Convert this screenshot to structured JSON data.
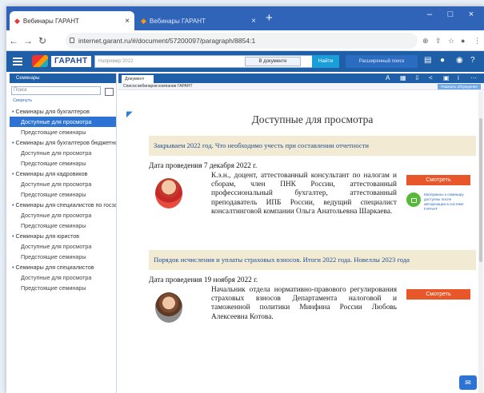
{
  "browser": {
    "tabs": [
      {
        "title": "Вебинары ГАРАНТ",
        "close": "×"
      },
      {
        "title": "Вебинары ГАРАНТ",
        "close": "×"
      }
    ],
    "new_tab": "+",
    "window_controls": [
      "–",
      "□",
      "×"
    ],
    "url": "internet.garant.ru/#/document/57200097/paragraph/8854:1"
  },
  "toolbar": {
    "logo": "ГАРАНТ",
    "search_placeholder": "Например 2022",
    "scope": "В документе",
    "find_label": "Найти",
    "extended_label": "Расширенный поиск"
  },
  "left_panel": {
    "title": "Семинары",
    "search_placeholder": "Поиск",
    "collapse_all": "Свернуть",
    "groups": [
      {
        "label": "Семинары для бухгалтеров",
        "items": [
          "Доступные для просмотра",
          "Предстоящие семинары"
        ]
      },
      {
        "label": "Семинары для бухгалтеров бюджетной сферы",
        "items": [
          "Доступные для просмотра",
          "Предстоящие семинары"
        ]
      },
      {
        "label": "Семинары для кадровиков",
        "items": [
          "Доступные для просмотра",
          "Предстоящие семинары"
        ]
      },
      {
        "label": "Семинары для специалистов по госзакупкам",
        "items": [
          "Доступные для просмотра",
          "Предстоящие семинары"
        ]
      },
      {
        "label": "Семинары для юристов",
        "items": [
          "Доступные для просмотра",
          "Предстоящие семинары"
        ]
      },
      {
        "label": "Семинары для специалистов",
        "items": [
          "Доступные для просмотра",
          "Предстоящие семинары"
        ]
      }
    ]
  },
  "doc": {
    "tab_label": "Документ",
    "breadcrumb": "Список вебинаров компании ГАРАНТ",
    "right_button": "Показать обсуждения",
    "page_title": "Доступные для просмотра",
    "entries": [
      {
        "topic": "Закрываем 2022 год. Что необходимо учесть при составлении отчетности",
        "date": "Дата проведения 7 декабря 2022 г.",
        "description": "К.э.н., доцент, аттестованный консультант по налогам и сборам, член ПНК России, аттестованный профессиональный бухгалтер, аттестованный преподаватель ИПБ России, ведущий специалист консалтинговой компании Ольга Анатольевна Шаркаева.",
        "button": "Смотреть",
        "download_note": "Материалы к семинару доступны после авторизации в системе ГАРАНТ"
      },
      {
        "topic": "Порядок исчисления и уплаты страховых взносов. Итоги 2022 года. Новеллы 2023 года",
        "date": "Дата проведения 19 ноября 2022 г.",
        "description": "Начальник отдела нормативно-правового регулирования страховых взносов Департамента налоговой и таможенной политики Минфина России Любовь Алексеевна Котова.",
        "button": "Смотреть"
      }
    ]
  },
  "colors": {
    "accent": "#1e5fa8",
    "selected": "#2d73d4",
    "watch_button": "#e8572a",
    "topic_bg": "#f2ead2"
  }
}
